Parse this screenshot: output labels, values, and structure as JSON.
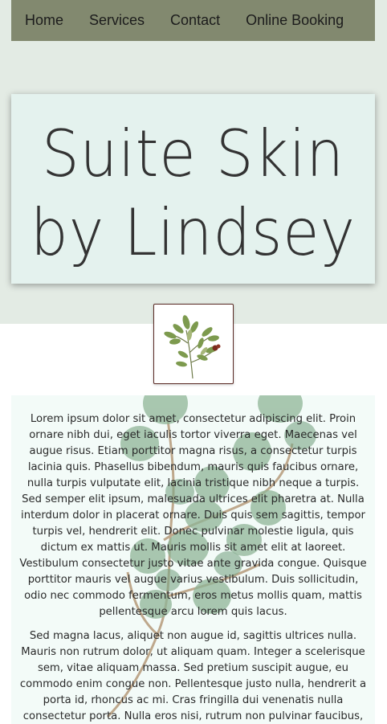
{
  "nav": {
    "items": [
      "Home",
      "Services",
      "Contact",
      "Online Booking"
    ]
  },
  "hero": {
    "title_line1": "Suite Skin",
    "title_line2": "by Lindsey"
  },
  "logo": {
    "icon": "botanical-sprig-icon"
  },
  "content": {
    "paragraph1": "Lorem ipsum dolor sit amet, consectetur adipiscing elit. Proin ornare nibh dui, eget iaculis tortor viverra eget. Maecenas vel augue risus. Etiam porttitor magna risus, a consectetur turpis lacinia quis. Phasellus bibendum, mauris quis faucibus ornare, nulla turpis vulputate elit, lacinia tristique nibh neque a turpis. Sed semper elit ipsum, malesuada ultrices elit pharetra at. Nulla interdum dolor in placerat ornare. Duis quis sem sagittis, tempor turpis vel, hendrerit elit. Donec pulvinar molestie ligula, quis dictum ex mattis ut. Mauris mollis sit amet elit at laoreet. Vestibulum consectetur justo vitae ante gravida congue. Quisque porttitor mauris vel augue varius vestibulum. Duis sollicitudin, odio nec commodo fermentum, eros metus mollis quam, mattis pellentesque arcu lorem quis lacus.",
    "paragraph2": "Sed magna lacus, aliquet non augue id, sagittis ultrices nulla. Mauris non rutrum dolor, ut aliquam quam. Integer a scelerisque sem, vitae aliquam massa. Sed pretium suscipit augue, eu commodo enim congue non. Pellentesque justo nulla, hendrerit a porta id, rhoncus ac mi. Cras fringilla dui venenatis nulla consectetur porta. Nulla eros nisi, rutrum non pulvinar faucibus, posuere vitae leo. Sed risus lorem, accumsan id augue eu, blandit dignissim nisl. Proin quis est congue,"
  },
  "colors": {
    "nav_bg": "#82896f",
    "top_band": "#e3ebe4",
    "hero_bg": "#e4f2ee",
    "content_bg": "#f3fbf8",
    "logo_border": "#5a2a24"
  }
}
